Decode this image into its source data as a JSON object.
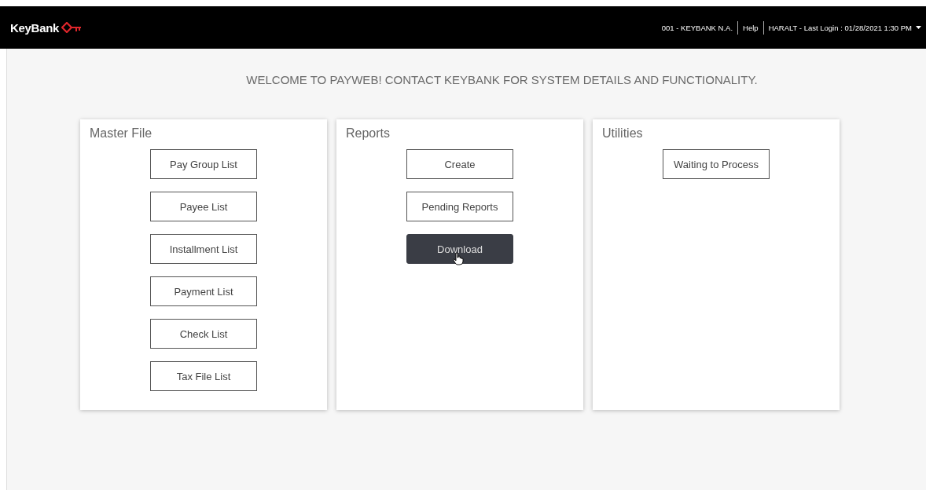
{
  "header": {
    "brand": "KeyBank",
    "institution": "001 -  KEYBANK N.A.",
    "help": "Help",
    "user": "HARALT - Last Login : 01/28/2021 1:30 PM"
  },
  "welcome": "WELCOME TO PAYWEB! CONTACT KEYBANK FOR SYSTEM DETAILS AND FUNCTIONALITY.",
  "panels": [
    {
      "title": "Master File",
      "buttons": [
        {
          "label": "Pay Group List",
          "hovered": false
        },
        {
          "label": "Payee List",
          "hovered": false
        },
        {
          "label": "Installment List",
          "hovered": false
        },
        {
          "label": "Payment List",
          "hovered": false
        },
        {
          "label": "Check List",
          "hovered": false
        },
        {
          "label": "Tax File List",
          "hovered": false
        }
      ]
    },
    {
      "title": "Reports",
      "buttons": [
        {
          "label": "Create",
          "hovered": false
        },
        {
          "label": "Pending Reports",
          "hovered": false
        },
        {
          "label": "Download",
          "hovered": true
        }
      ]
    },
    {
      "title": "Utilities",
      "buttons": [
        {
          "label": "Waiting to Process",
          "hovered": false
        }
      ]
    }
  ]
}
